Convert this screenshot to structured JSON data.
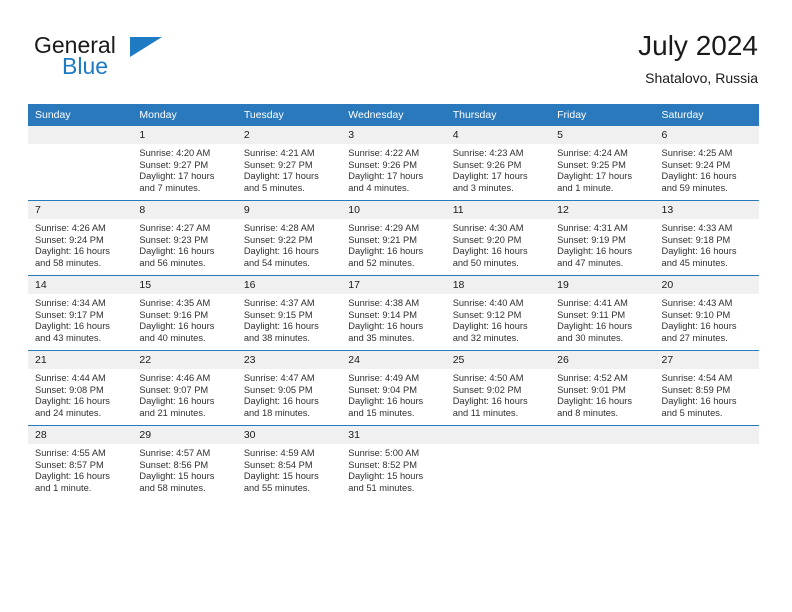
{
  "brand": {
    "name_part1": "General",
    "name_part2": "Blue",
    "triangle_icon": "triangle-icon",
    "accent_color": "#1f7ac4"
  },
  "header": {
    "title": "July 2024",
    "subtitle": "Shatalovo, Russia"
  },
  "theme": {
    "header_row_bg": "#2b79bd",
    "daynum_bg": "#f0f0f0",
    "text_color": "#303030"
  },
  "calendar": {
    "weekday_headers": [
      "Sunday",
      "Monday",
      "Tuesday",
      "Wednesday",
      "Thursday",
      "Friday",
      "Saturday"
    ],
    "weeks": [
      [
        {
          "day": "",
          "sunrise": "",
          "sunset": "",
          "daylight_line1": "",
          "daylight_line2": ""
        },
        {
          "day": "1",
          "sunrise": "Sunrise: 4:20 AM",
          "sunset": "Sunset: 9:27 PM",
          "daylight_line1": "Daylight: 17 hours",
          "daylight_line2": "and 7 minutes."
        },
        {
          "day": "2",
          "sunrise": "Sunrise: 4:21 AM",
          "sunset": "Sunset: 9:27 PM",
          "daylight_line1": "Daylight: 17 hours",
          "daylight_line2": "and 5 minutes."
        },
        {
          "day": "3",
          "sunrise": "Sunrise: 4:22 AM",
          "sunset": "Sunset: 9:26 PM",
          "daylight_line1": "Daylight: 17 hours",
          "daylight_line2": "and 4 minutes."
        },
        {
          "day": "4",
          "sunrise": "Sunrise: 4:23 AM",
          "sunset": "Sunset: 9:26 PM",
          "daylight_line1": "Daylight: 17 hours",
          "daylight_line2": "and 3 minutes."
        },
        {
          "day": "5",
          "sunrise": "Sunrise: 4:24 AM",
          "sunset": "Sunset: 9:25 PM",
          "daylight_line1": "Daylight: 17 hours",
          "daylight_line2": "and 1 minute."
        },
        {
          "day": "6",
          "sunrise": "Sunrise: 4:25 AM",
          "sunset": "Sunset: 9:24 PM",
          "daylight_line1": "Daylight: 16 hours",
          "daylight_line2": "and 59 minutes."
        }
      ],
      [
        {
          "day": "7",
          "sunrise": "Sunrise: 4:26 AM",
          "sunset": "Sunset: 9:24 PM",
          "daylight_line1": "Daylight: 16 hours",
          "daylight_line2": "and 58 minutes."
        },
        {
          "day": "8",
          "sunrise": "Sunrise: 4:27 AM",
          "sunset": "Sunset: 9:23 PM",
          "daylight_line1": "Daylight: 16 hours",
          "daylight_line2": "and 56 minutes."
        },
        {
          "day": "9",
          "sunrise": "Sunrise: 4:28 AM",
          "sunset": "Sunset: 9:22 PM",
          "daylight_line1": "Daylight: 16 hours",
          "daylight_line2": "and 54 minutes."
        },
        {
          "day": "10",
          "sunrise": "Sunrise: 4:29 AM",
          "sunset": "Sunset: 9:21 PM",
          "daylight_line1": "Daylight: 16 hours",
          "daylight_line2": "and 52 minutes."
        },
        {
          "day": "11",
          "sunrise": "Sunrise: 4:30 AM",
          "sunset": "Sunset: 9:20 PM",
          "daylight_line1": "Daylight: 16 hours",
          "daylight_line2": "and 50 minutes."
        },
        {
          "day": "12",
          "sunrise": "Sunrise: 4:31 AM",
          "sunset": "Sunset: 9:19 PM",
          "daylight_line1": "Daylight: 16 hours",
          "daylight_line2": "and 47 minutes."
        },
        {
          "day": "13",
          "sunrise": "Sunrise: 4:33 AM",
          "sunset": "Sunset: 9:18 PM",
          "daylight_line1": "Daylight: 16 hours",
          "daylight_line2": "and 45 minutes."
        }
      ],
      [
        {
          "day": "14",
          "sunrise": "Sunrise: 4:34 AM",
          "sunset": "Sunset: 9:17 PM",
          "daylight_line1": "Daylight: 16 hours",
          "daylight_line2": "and 43 minutes."
        },
        {
          "day": "15",
          "sunrise": "Sunrise: 4:35 AM",
          "sunset": "Sunset: 9:16 PM",
          "daylight_line1": "Daylight: 16 hours",
          "daylight_line2": "and 40 minutes."
        },
        {
          "day": "16",
          "sunrise": "Sunrise: 4:37 AM",
          "sunset": "Sunset: 9:15 PM",
          "daylight_line1": "Daylight: 16 hours",
          "daylight_line2": "and 38 minutes."
        },
        {
          "day": "17",
          "sunrise": "Sunrise: 4:38 AM",
          "sunset": "Sunset: 9:14 PM",
          "daylight_line1": "Daylight: 16 hours",
          "daylight_line2": "and 35 minutes."
        },
        {
          "day": "18",
          "sunrise": "Sunrise: 4:40 AM",
          "sunset": "Sunset: 9:12 PM",
          "daylight_line1": "Daylight: 16 hours",
          "daylight_line2": "and 32 minutes."
        },
        {
          "day": "19",
          "sunrise": "Sunrise: 4:41 AM",
          "sunset": "Sunset: 9:11 PM",
          "daylight_line1": "Daylight: 16 hours",
          "daylight_line2": "and 30 minutes."
        },
        {
          "day": "20",
          "sunrise": "Sunrise: 4:43 AM",
          "sunset": "Sunset: 9:10 PM",
          "daylight_line1": "Daylight: 16 hours",
          "daylight_line2": "and 27 minutes."
        }
      ],
      [
        {
          "day": "21",
          "sunrise": "Sunrise: 4:44 AM",
          "sunset": "Sunset: 9:08 PM",
          "daylight_line1": "Daylight: 16 hours",
          "daylight_line2": "and 24 minutes."
        },
        {
          "day": "22",
          "sunrise": "Sunrise: 4:46 AM",
          "sunset": "Sunset: 9:07 PM",
          "daylight_line1": "Daylight: 16 hours",
          "daylight_line2": "and 21 minutes."
        },
        {
          "day": "23",
          "sunrise": "Sunrise: 4:47 AM",
          "sunset": "Sunset: 9:05 PM",
          "daylight_line1": "Daylight: 16 hours",
          "daylight_line2": "and 18 minutes."
        },
        {
          "day": "24",
          "sunrise": "Sunrise: 4:49 AM",
          "sunset": "Sunset: 9:04 PM",
          "daylight_line1": "Daylight: 16 hours",
          "daylight_line2": "and 15 minutes."
        },
        {
          "day": "25",
          "sunrise": "Sunrise: 4:50 AM",
          "sunset": "Sunset: 9:02 PM",
          "daylight_line1": "Daylight: 16 hours",
          "daylight_line2": "and 11 minutes."
        },
        {
          "day": "26",
          "sunrise": "Sunrise: 4:52 AM",
          "sunset": "Sunset: 9:01 PM",
          "daylight_line1": "Daylight: 16 hours",
          "daylight_line2": "and 8 minutes."
        },
        {
          "day": "27",
          "sunrise": "Sunrise: 4:54 AM",
          "sunset": "Sunset: 8:59 PM",
          "daylight_line1": "Daylight: 16 hours",
          "daylight_line2": "and 5 minutes."
        }
      ],
      [
        {
          "day": "28",
          "sunrise": "Sunrise: 4:55 AM",
          "sunset": "Sunset: 8:57 PM",
          "daylight_line1": "Daylight: 16 hours",
          "daylight_line2": "and 1 minute."
        },
        {
          "day": "29",
          "sunrise": "Sunrise: 4:57 AM",
          "sunset": "Sunset: 8:56 PM",
          "daylight_line1": "Daylight: 15 hours",
          "daylight_line2": "and 58 minutes."
        },
        {
          "day": "30",
          "sunrise": "Sunrise: 4:59 AM",
          "sunset": "Sunset: 8:54 PM",
          "daylight_line1": "Daylight: 15 hours",
          "daylight_line2": "and 55 minutes."
        },
        {
          "day": "31",
          "sunrise": "Sunrise: 5:00 AM",
          "sunset": "Sunset: 8:52 PM",
          "daylight_line1": "Daylight: 15 hours",
          "daylight_line2": "and 51 minutes."
        },
        {
          "day": "",
          "sunrise": "",
          "sunset": "",
          "daylight_line1": "",
          "daylight_line2": ""
        },
        {
          "day": "",
          "sunrise": "",
          "sunset": "",
          "daylight_line1": "",
          "daylight_line2": ""
        },
        {
          "day": "",
          "sunrise": "",
          "sunset": "",
          "daylight_line1": "",
          "daylight_line2": ""
        }
      ]
    ]
  }
}
